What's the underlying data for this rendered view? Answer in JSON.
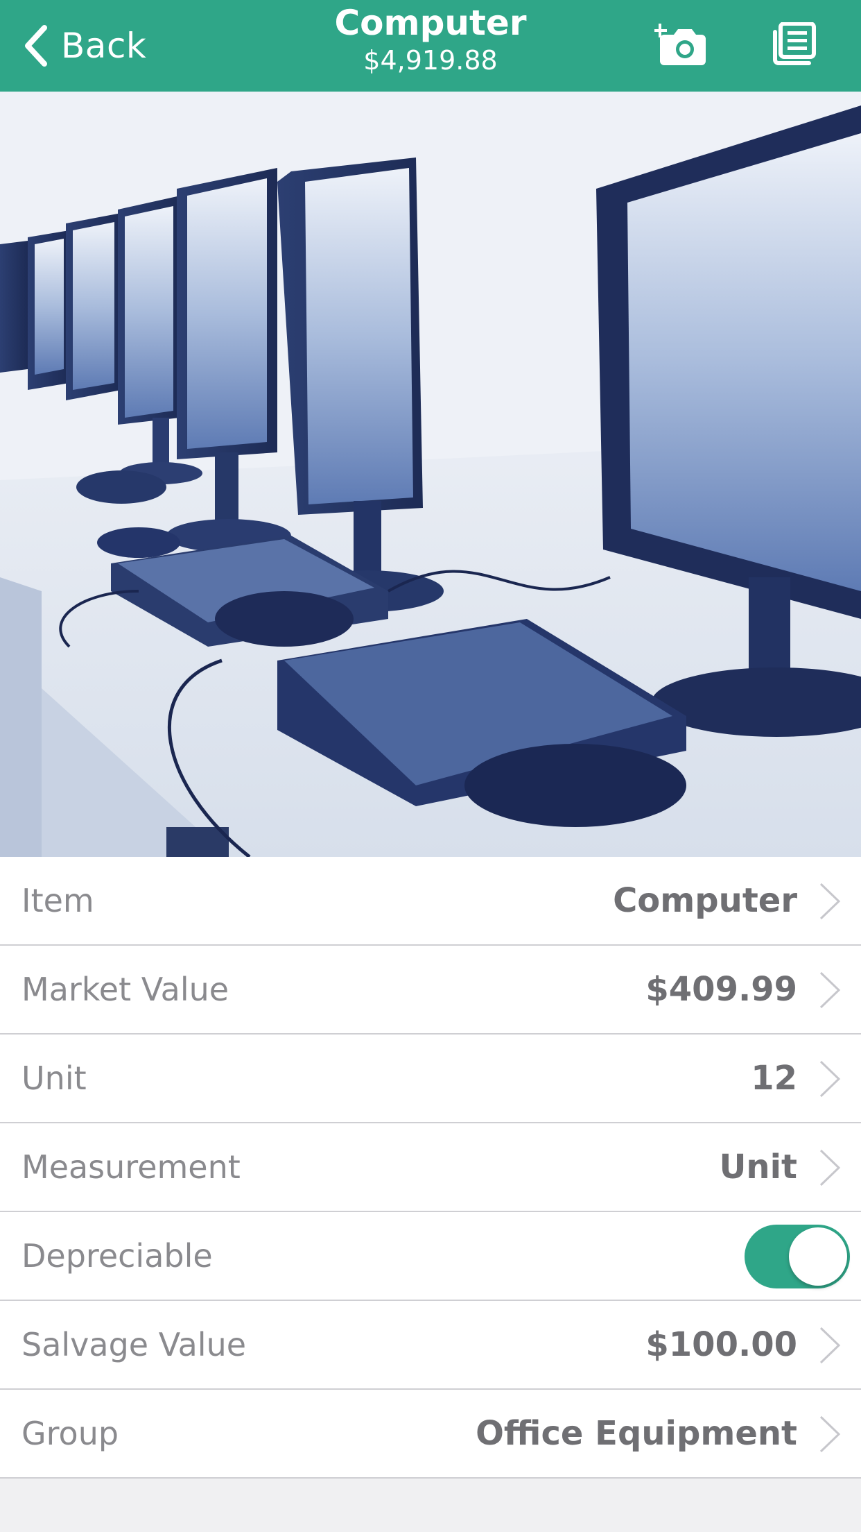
{
  "colors": {
    "accent": "#2fa688",
    "label": "#8a8a8e",
    "value": "#6f6f73",
    "background": "#f0f0f2"
  },
  "nav": {
    "back_label": "Back",
    "back_icon": "chevron-left-icon",
    "title": "Computer",
    "subtitle": "$4,919.88",
    "add_photo_icon": "add-photo-camera-icon",
    "list_icon": "document-list-icon"
  },
  "photo": {
    "description_icon": "item-photo",
    "subject": "computer workstations"
  },
  "fields": {
    "item": {
      "label": "Item",
      "value": "Computer"
    },
    "market_value": {
      "label": "Market Value",
      "value": "$409.99"
    },
    "unit": {
      "label": "Unit",
      "value": "12"
    },
    "measurement": {
      "label": "Measurement",
      "value": "Unit"
    },
    "depreciable": {
      "label": "Depreciable",
      "on": true
    },
    "salvage_value": {
      "label": "Salvage Value",
      "value": "$100.00"
    },
    "group": {
      "label": "Group",
      "value": "Office Equipment"
    }
  }
}
